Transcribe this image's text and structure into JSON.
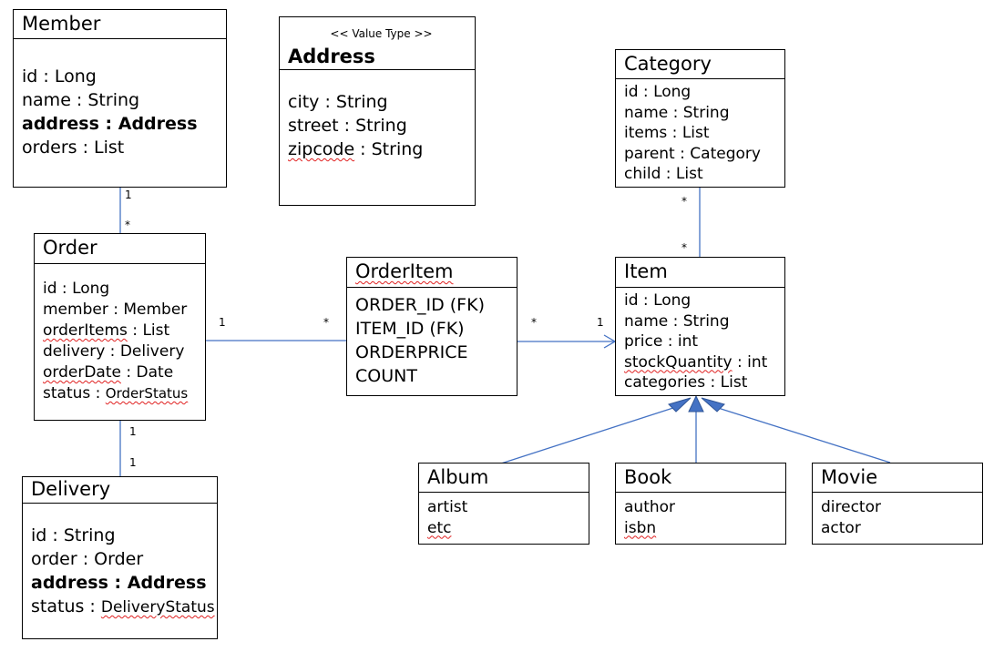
{
  "colors": {
    "line": "#4472c4",
    "border": "#000000",
    "squiggle": "#e02020"
  },
  "classes": [
    {
      "id": "member",
      "name": "Member",
      "attributes": [
        {
          "name": "id",
          "type": "Long"
        },
        {
          "name": "name",
          "type": "String"
        },
        {
          "name": "address",
          "type": "Address",
          "bold": true
        },
        {
          "name": "orders",
          "type": "List"
        }
      ]
    },
    {
      "id": "address",
      "stereotype": "<< Value Type >>",
      "name": "Address",
      "name_bold": true,
      "attributes": [
        {
          "name": "city",
          "type": "String"
        },
        {
          "name": "street",
          "type": "String"
        },
        {
          "name": "zipcode",
          "type": "String",
          "sq_name": true
        }
      ]
    },
    {
      "id": "category",
      "name": "Category",
      "attributes": [
        {
          "name": "id",
          "type": "Long"
        },
        {
          "name": "name",
          "type": "String"
        },
        {
          "name": "items",
          "type": "List"
        },
        {
          "name": "parent",
          "type": "Category"
        },
        {
          "name": "child",
          "type": "List"
        }
      ]
    },
    {
      "id": "order",
      "name": "Order",
      "attributes": [
        {
          "name": "id",
          "type": "Long"
        },
        {
          "name": "member",
          "type": "Member"
        },
        {
          "name": "orderItems",
          "type": "List",
          "sq_name": true
        },
        {
          "name": "delivery",
          "type": "Delivery"
        },
        {
          "name": "orderDate",
          "type": "Date",
          "sq_name": true
        },
        {
          "name": "status",
          "type": "OrderStatus",
          "sq_type": true
        }
      ]
    },
    {
      "id": "orderitem",
      "name": "OrderItem",
      "sq_title": true,
      "attributes": [
        {
          "text": "ORDER_ID (FK)"
        },
        {
          "text": "ITEM_ID (FK)"
        },
        {
          "text": "ORDERPRICE"
        },
        {
          "text": "COUNT"
        }
      ]
    },
    {
      "id": "item",
      "name": "Item",
      "attributes": [
        {
          "name": "id",
          "type": "Long"
        },
        {
          "name": "name",
          "type": "String"
        },
        {
          "name": "price",
          "type": "int"
        },
        {
          "name": "stockQuantity",
          "type": "int",
          "sq_name": true
        },
        {
          "name": "categories",
          "type": "List"
        }
      ]
    },
    {
      "id": "delivery",
      "name": "Delivery",
      "attributes": [
        {
          "name": "id",
          "type": "String"
        },
        {
          "name": "order",
          "type": "Order"
        },
        {
          "name": "address",
          "type": "Address",
          "bold": true
        },
        {
          "name": "status",
          "type": "DeliveryStatus",
          "sq_type": true
        }
      ]
    },
    {
      "id": "album",
      "name": "Album",
      "attributes": [
        {
          "text": "artist"
        },
        {
          "text": "etc",
          "sq": true
        }
      ]
    },
    {
      "id": "book",
      "name": "Book",
      "attributes": [
        {
          "text": "author"
        },
        {
          "text": "isbn",
          "sq": true
        }
      ]
    },
    {
      "id": "movie",
      "name": "Movie",
      "attributes": [
        {
          "text": "director"
        },
        {
          "text": "actor"
        }
      ]
    }
  ],
  "associations": [
    {
      "from": "Member",
      "to": "Order",
      "from_mult": "1",
      "to_mult": "*"
    },
    {
      "from": "Order",
      "to": "Delivery",
      "from_mult": "1",
      "to_mult": "1"
    },
    {
      "from": "Order",
      "to": "OrderItem",
      "from_mult": "1",
      "to_mult": "*"
    },
    {
      "from": "OrderItem",
      "to": "Item",
      "from_mult": "*",
      "to_mult": "1",
      "navigable": true
    },
    {
      "from": "Category",
      "to": "Item",
      "from_mult": "*",
      "to_mult": "*"
    }
  ],
  "generalizations": [
    {
      "child": "Album",
      "parent": "Item"
    },
    {
      "child": "Book",
      "parent": "Item"
    },
    {
      "child": "Movie",
      "parent": "Item"
    }
  ]
}
